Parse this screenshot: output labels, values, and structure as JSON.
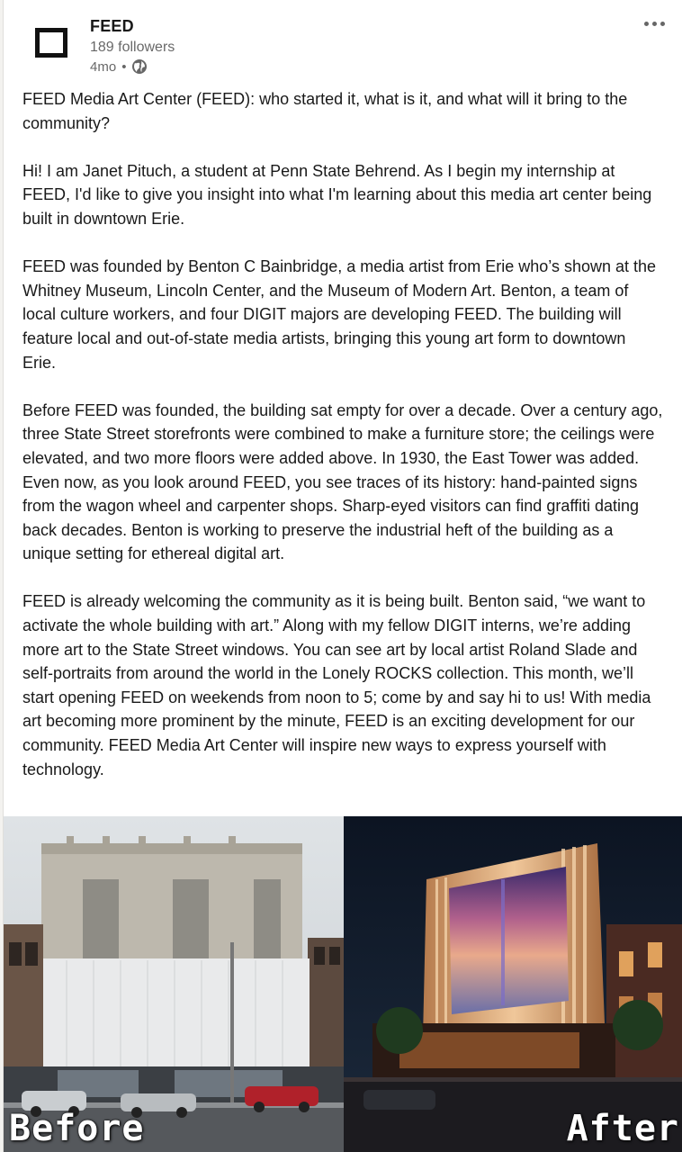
{
  "post": {
    "company_name": "FEED",
    "followers": "189 followers",
    "age": "4mo",
    "dot": "•",
    "paragraphs": [
      "FEED Media Art Center (FEED): who started it, what is it, and what will it bring to the community?",
      "Hi! I am Janet Pituch, a student at Penn State Behrend. As I begin my internship at FEED, I'd like to give you insight into what I'm learning about this media art center being built in downtown Erie.",
      "FEED was founded by Benton C Bainbridge, a media artist from Erie who’s shown at the Whitney Museum, Lincoln Center, and the Museum of Modern Art. Benton, a team of local culture workers, and four DIGIT majors are developing FEED. The building will feature local and out-of-state media artists, bringing this young art form to downtown Erie.",
      "Before FEED was founded, the building sat empty for over a decade. Over a century ago, three State Street storefronts were combined to make a furniture store; the ceilings were elevated, and two more floors were added above. In 1930, the East Tower was added. Even now, as you look around FEED, you see traces of its history: hand-painted signs from the wagon wheel and carpenter shops. Sharp-eyed visitors can find graffiti dating back decades. Benton is working to preserve the industrial heft of the building as a unique setting for ethereal digital art.",
      "FEED is already welcoming the community as it is being built. Benton said, “we want to activate the whole building with art.” Along with my fellow DIGIT interns, we’re adding more art to the State Street windows. You can see art by local artist Roland Slade and self-portraits from around the world in the Lonely ROCKS collection. This month, we’ll start opening FEED on weekends from noon to 5; come by and say hi to us! With media art becoming more prominent by the minute, FEED is an exciting development for our community. FEED Media Art Center will inspire new ways to express yourself with technology."
    ],
    "image": {
      "before_label": "Before",
      "after_label": "After"
    }
  },
  "icons": {
    "logo": "feed-logo-icon",
    "visibility": "globe-icon",
    "menu": "more-horizontal-icon"
  },
  "colors": {
    "secondary_text": "#666666",
    "primary_text": "#191919"
  }
}
